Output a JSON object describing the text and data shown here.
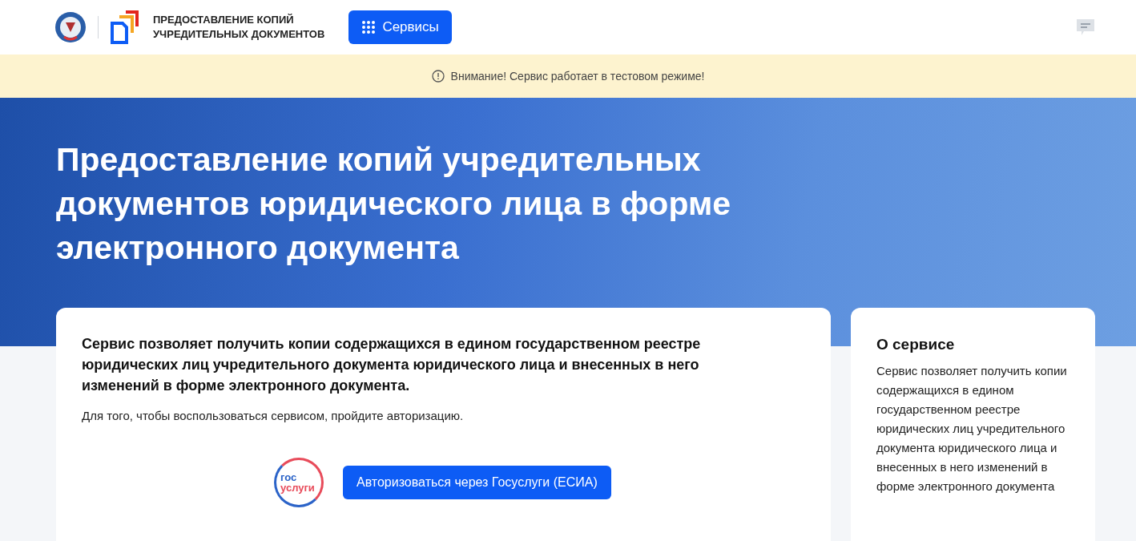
{
  "header": {
    "title_lines": [
      "ПРЕДОСТАВЛЕНИЕ КОПИЙ",
      "УЧРЕДИТЕЛЬНЫХ ДОКУМЕНТОВ"
    ],
    "services_button": "Сервисы"
  },
  "notice": {
    "text": "Внимание! Сервис работает в тестовом режиме!"
  },
  "hero": {
    "title": "Предоставление копий учредительных документов юридического лица в форме электронного документа"
  },
  "main_card": {
    "lead": "Сервис позволяет получить копии содержащихся в едином государственном реестре юридических лиц учредительного документа юридического лица и внесенных в него изменений в форме электронного документа.",
    "hint": "Для того, чтобы воспользоваться сервисом, пройдите авторизацию.",
    "logo_lines": [
      "гос",
      "услуги"
    ],
    "auth_button": "Авторизоваться через Госуслуги (ЕСИА)"
  },
  "side_card": {
    "title": "О сервисе",
    "text": "Сервис позволяет получить копии содержащихся в едином государственном реестре юридических лиц учредительного документа юридического лица и внесенных в него изменений в форме электронного документа"
  }
}
